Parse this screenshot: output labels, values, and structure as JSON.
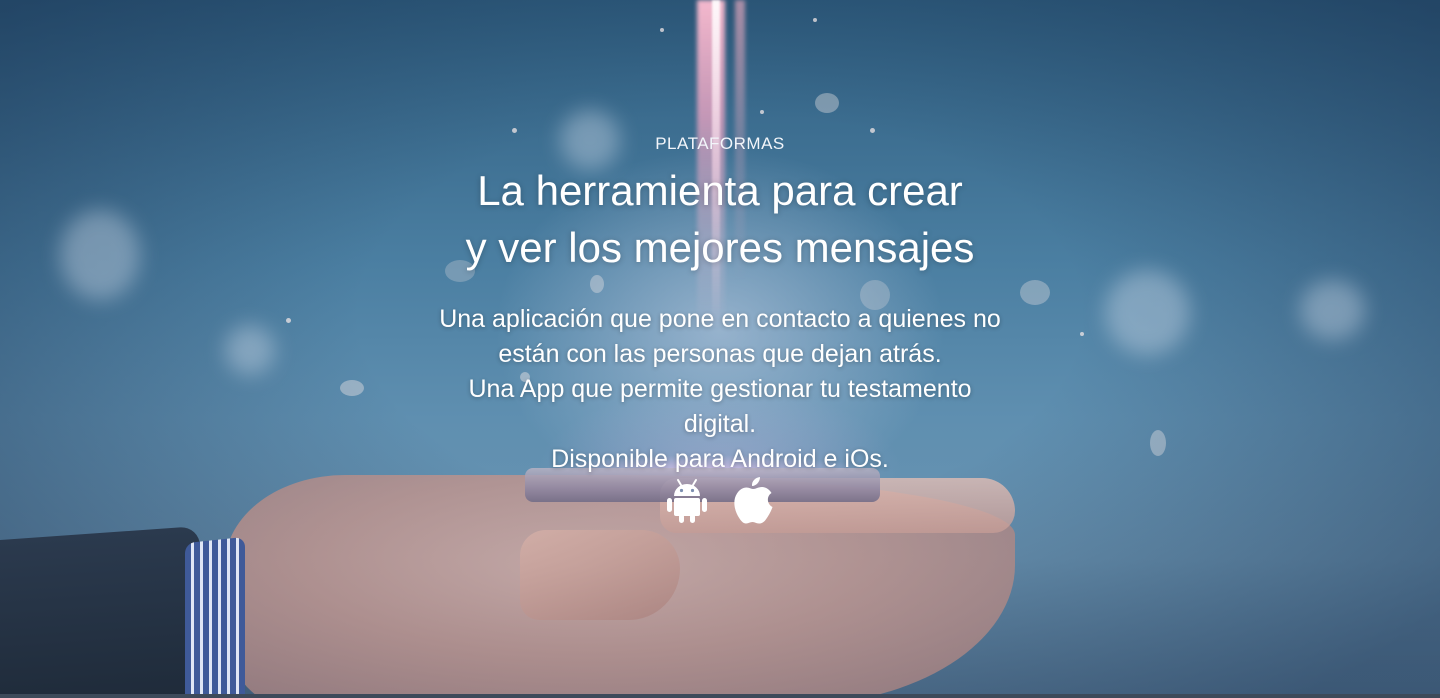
{
  "hero": {
    "eyebrow": "PLATAFORMAS",
    "headline_line1": "La herramienta para crear",
    "headline_line2": "y ver los mejores mensajes",
    "description_lines": [
      "Una aplicación que pone en contacto a quienes no",
      "están con las personas que dejan atrás.",
      "Una App que permite gestionar tu testamento",
      "digital.",
      "Disponible para Android e iOs."
    ],
    "platforms": [
      {
        "name": "Android",
        "icon": "android-icon"
      },
      {
        "name": "iOS",
        "icon": "apple-icon"
      }
    ]
  },
  "colors": {
    "text": "#ffffff",
    "background_top": "#2f5e80",
    "background_mid": "#5f8fb0",
    "beam": "#ffbed2"
  }
}
